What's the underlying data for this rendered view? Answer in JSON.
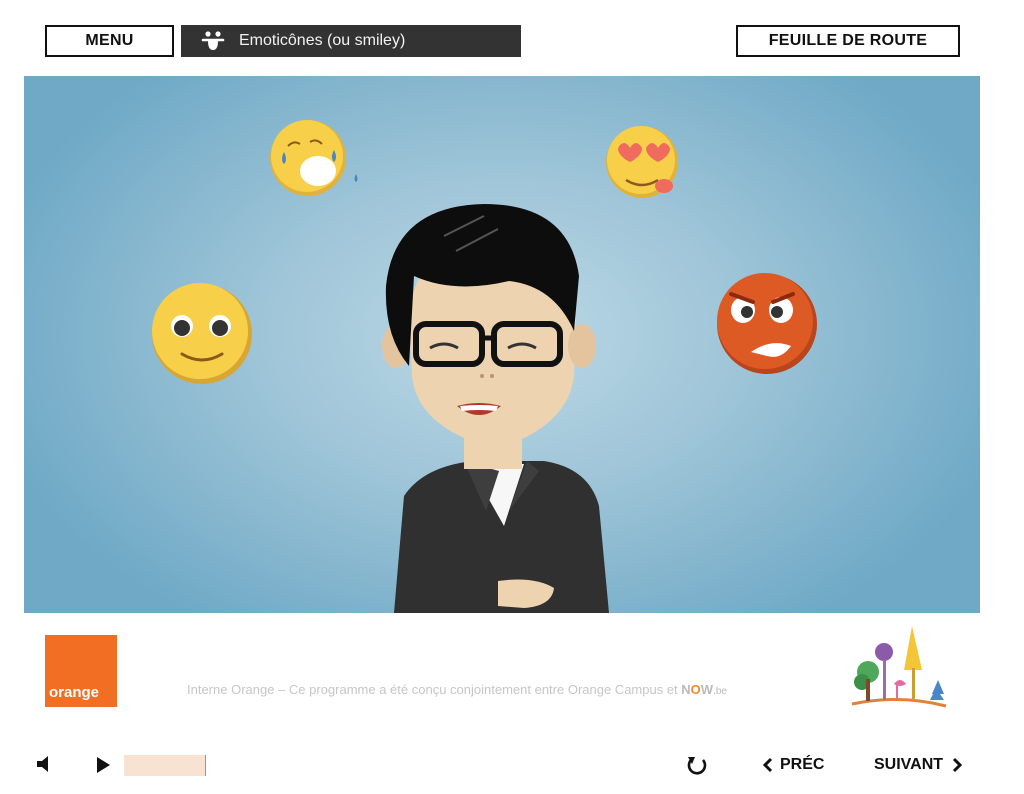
{
  "header": {
    "menu_label": "MENU",
    "title": "Emoticônes (ou smiley)",
    "roadmap_label": "FEUILLE DE ROUTE"
  },
  "footer": {
    "notice_text": "Interne Orange – Ce programme a été conçu conjointement entre Orange Campus et ",
    "partner_now_pre": "N",
    "partner_now_o": "O",
    "partner_now_post": "W",
    "partner_be": ".be",
    "orange_logo_text": "orange"
  },
  "controls": {
    "prev_label": "PRÉC",
    "next_label": "SUIVANT",
    "prev_icon": "chevron-left-icon",
    "next_icon": "chevron-right-icon",
    "progress": 0.0
  },
  "colors": {
    "orange": "#f16e22",
    "title_bar": "#333333",
    "stage_bg": "#9fc5d8"
  }
}
